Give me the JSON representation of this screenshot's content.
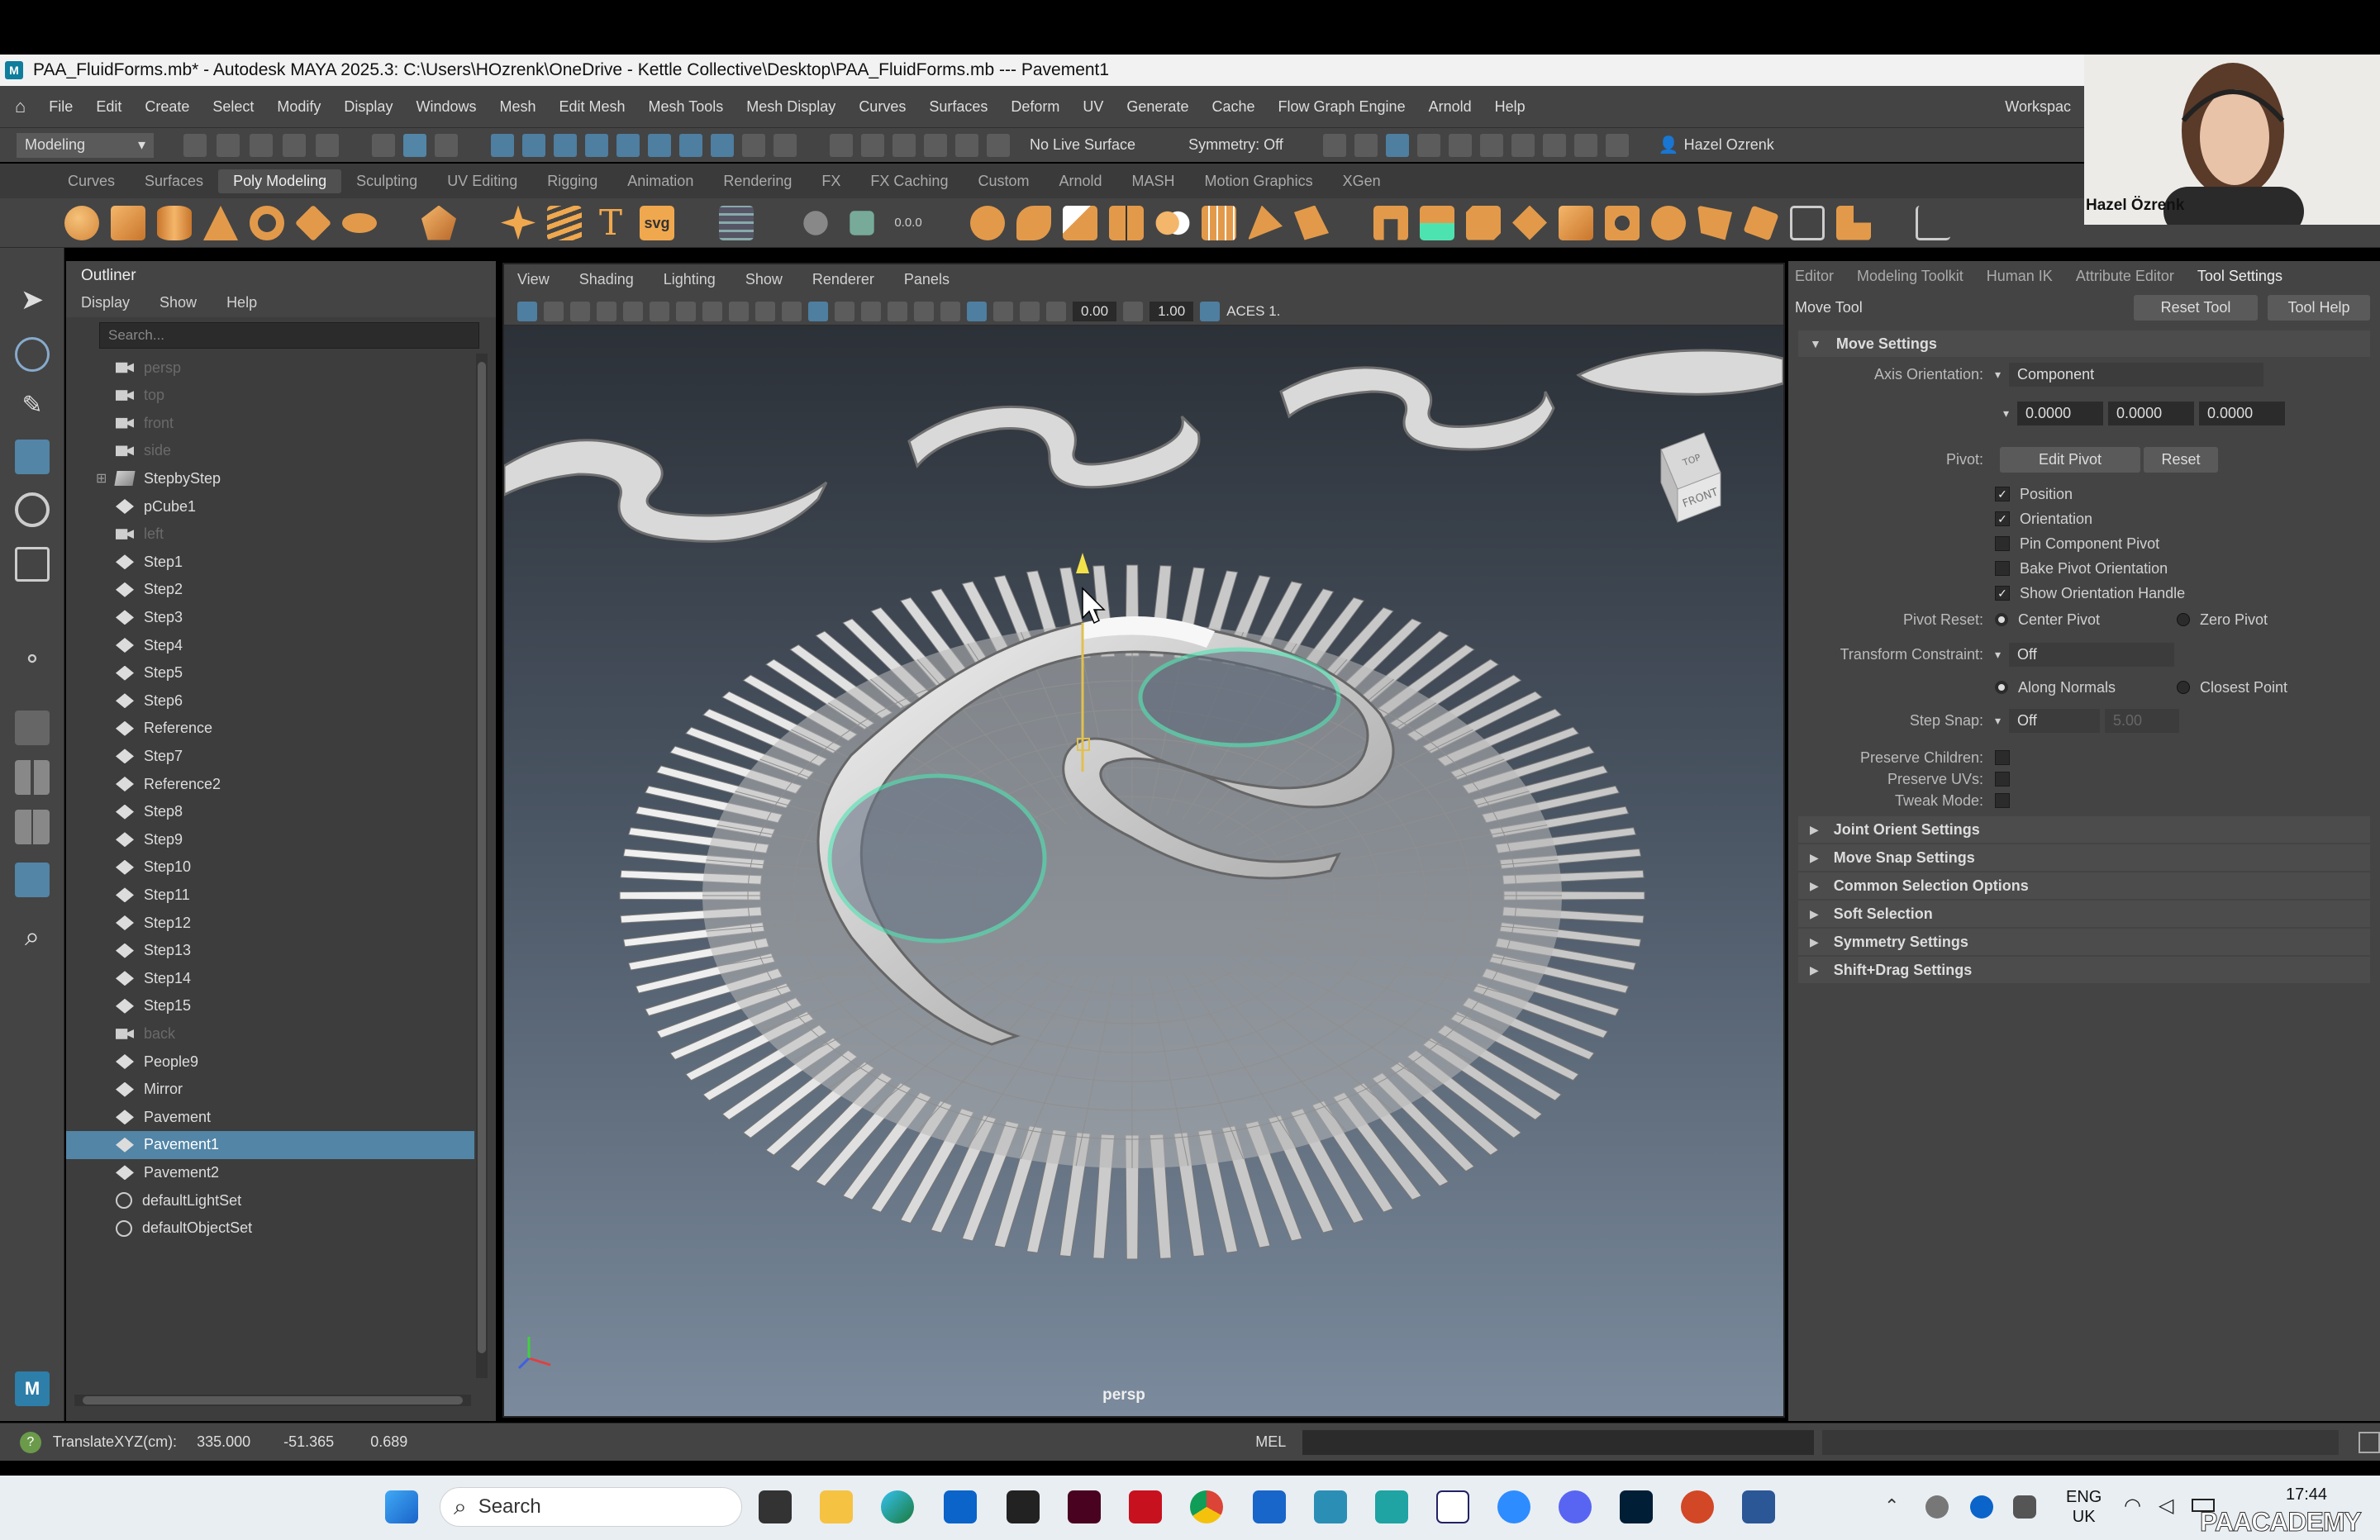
{
  "window": {
    "title": "PAA_FluidForms.mb* - Autodesk MAYA 2025.3: C:\\Users\\HOzrenk\\OneDrive - Kettle Collective\\Desktop\\PAA_FluidForms.mb   ---   Pavement1"
  },
  "menubar": {
    "items": [
      "File",
      "Edit",
      "Create",
      "Select",
      "Modify",
      "Display",
      "Windows",
      "Mesh",
      "Edit Mesh",
      "Mesh Tools",
      "Mesh Display",
      "Curves",
      "Surfaces",
      "Deform",
      "UV",
      "Generate",
      "Cache",
      "Flow Graph Engine",
      "Arnold",
      "Help"
    ],
    "workspace": "Workspac"
  },
  "statusline": {
    "mode": "Modeling",
    "live_surface": "No Live Surface",
    "symmetry": "Symmetry: Off",
    "user": "Hazel Ozrenk"
  },
  "shelf": {
    "tabs": [
      "Curves",
      "Surfaces",
      "Poly Modeling",
      "Sculpting",
      "UV Editing",
      "Rigging",
      "Animation",
      "Rendering",
      "FX",
      "FX Caching",
      "Custom",
      "Arnold",
      "MASH",
      "Motion Graphics",
      "XGen"
    ],
    "active": "Poly Modeling",
    "svg_label": "svg",
    "num_label": "0.0.0"
  },
  "outliner": {
    "title": "Outliner",
    "menu": [
      "Display",
      "Show",
      "Help"
    ],
    "search_placeholder": "Search...",
    "items": [
      {
        "label": "persp",
        "type": "camera",
        "dim": true
      },
      {
        "label": "top",
        "type": "camera",
        "dim": true
      },
      {
        "label": "front",
        "type": "camera",
        "dim": true
      },
      {
        "label": "side",
        "type": "camera",
        "dim": true
      },
      {
        "label": "StepbyStep",
        "type": "group",
        "dim": false
      },
      {
        "label": "pCube1",
        "type": "mesh",
        "dim": false
      },
      {
        "label": "left",
        "type": "camera",
        "dim": true
      },
      {
        "label": "Step1",
        "type": "mesh",
        "dim": false
      },
      {
        "label": "Step2",
        "type": "mesh",
        "dim": false
      },
      {
        "label": "Step3",
        "type": "mesh",
        "dim": false
      },
      {
        "label": "Step4",
        "type": "mesh",
        "dim": false
      },
      {
        "label": "Step5",
        "type": "mesh",
        "dim": false
      },
      {
        "label": "Step6",
        "type": "mesh",
        "dim": false
      },
      {
        "label": "Reference",
        "type": "mesh",
        "dim": false
      },
      {
        "label": "Step7",
        "type": "mesh",
        "dim": false
      },
      {
        "label": "Reference2",
        "type": "mesh",
        "dim": false
      },
      {
        "label": "Step8",
        "type": "mesh",
        "dim": false
      },
      {
        "label": "Step9",
        "type": "mesh",
        "dim": false
      },
      {
        "label": "Step10",
        "type": "mesh",
        "dim": false
      },
      {
        "label": "Step11",
        "type": "mesh",
        "dim": false
      },
      {
        "label": "Step12",
        "type": "mesh",
        "dim": false
      },
      {
        "label": "Step13",
        "type": "mesh",
        "dim": false
      },
      {
        "label": "Step14",
        "type": "mesh",
        "dim": false
      },
      {
        "label": "Step15",
        "type": "mesh",
        "dim": false
      },
      {
        "label": "back",
        "type": "camera",
        "dim": true
      },
      {
        "label": "People9",
        "type": "mesh",
        "dim": false
      },
      {
        "label": "Mirror",
        "type": "mesh",
        "dim": false
      },
      {
        "label": "Pavement",
        "type": "mesh",
        "dim": false
      },
      {
        "label": "Pavement1",
        "type": "mesh",
        "dim": false,
        "selected": true
      },
      {
        "label": "Pavement2",
        "type": "mesh",
        "dim": false
      },
      {
        "label": "defaultLightSet",
        "type": "set",
        "dim": false
      },
      {
        "label": "defaultObjectSet",
        "type": "set",
        "dim": false
      }
    ]
  },
  "viewport": {
    "menu": [
      "View",
      "Shading",
      "Lighting",
      "Show",
      "Renderer",
      "Panels"
    ],
    "exposure": "0.00",
    "gamma": "1.00",
    "color_space": "ACES 1.",
    "camera_label": "persp",
    "viewcube": [
      "TOP",
      "FRONT"
    ]
  },
  "tool_settings": {
    "tabs": [
      "Editor",
      "Modeling Toolkit",
      "Human IK",
      "Attribute Editor",
      "Tool Settings"
    ],
    "active_tab": "Tool Settings",
    "tool_name": "Move Tool",
    "reset_tool": "Reset Tool",
    "tool_help": "Tool Help",
    "section_move": "Move Settings",
    "axis_orientation_label": "Axis Orientation:",
    "axis_orientation_value": "Component",
    "axis_values": [
      "0.0000",
      "0.0000",
      "0.0000"
    ],
    "pivot_label": "Pivot:",
    "edit_pivot": "Edit Pivot",
    "reset": "Reset",
    "checks": [
      {
        "label": "Position",
        "checked": true
      },
      {
        "label": "Orientation",
        "checked": true
      },
      {
        "label": "Pin Component Pivot",
        "checked": false
      },
      {
        "label": "Bake Pivot Orientation",
        "checked": false
      },
      {
        "label": "Show Orientation Handle",
        "checked": true
      }
    ],
    "pivot_reset_label": "Pivot Reset:",
    "center_pivot": "Center Pivot",
    "zero_pivot": "Zero Pivot",
    "transform_constraint_label": "Transform Constraint:",
    "transform_constraint_value": "Off",
    "along_normals": "Along Normals",
    "closest_point": "Closest Point",
    "step_snap_label": "Step Snap:",
    "step_snap_value": "Off",
    "step_snap_amount": "5.00",
    "preserve_children": "Preserve Children:",
    "preserve_uvs": "Preserve UVs:",
    "tweak_mode": "Tweak Mode:",
    "sections": [
      "Joint Orient Settings",
      "Move Snap Settings",
      "Common Selection Options",
      "Soft Selection",
      "Symmetry Settings",
      "Shift+Drag Settings"
    ]
  },
  "helpline": {
    "label": "TranslateXYZ(cm):",
    "x": "335.000",
    "y": "-51.365",
    "z": "0.689",
    "mel": "MEL"
  },
  "taskbar": {
    "search": "Search",
    "lang": "ENG",
    "region": "UK",
    "time": "17:44",
    "watermark": "PAACADEMY"
  },
  "webcam": {
    "name": "Hazel Özrenk"
  },
  "colors": {
    "selection": "#5285a6",
    "accent_green": "#4de3b0",
    "maya_teal": "#0f7d9c"
  }
}
